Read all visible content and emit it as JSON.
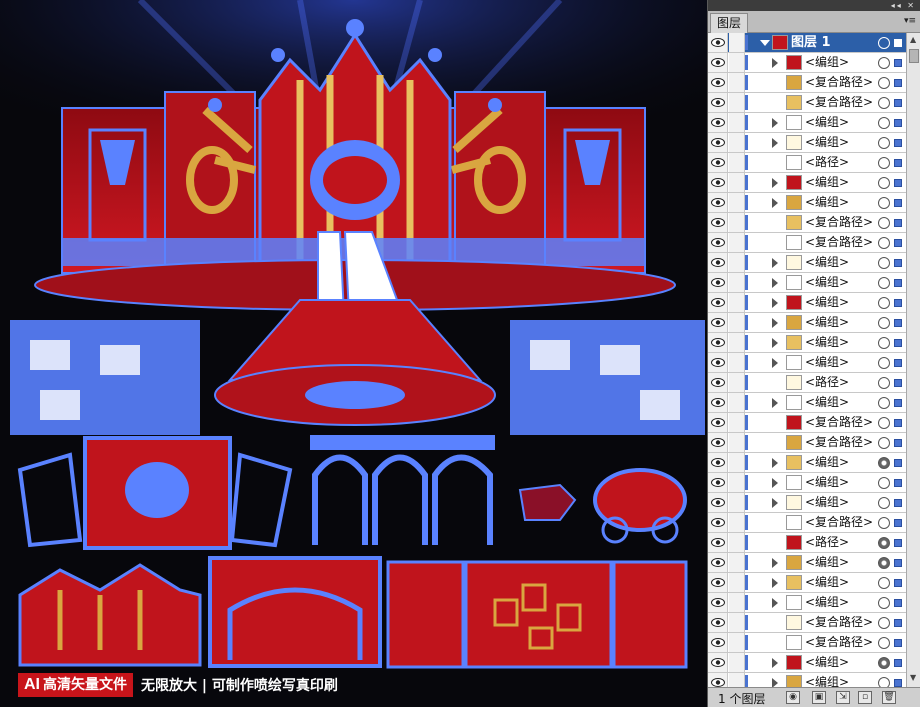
{
  "panel": {
    "tab_label": "图层",
    "menu_icon": "panel-menu-icon",
    "top_layer": {
      "label": "图层 1"
    },
    "rows": [
      {
        "label": "<编组>",
        "expand": true,
        "target": "empty"
      },
      {
        "label": "<复合路径>",
        "expand": false,
        "target": "empty"
      },
      {
        "label": "<复合路径>",
        "expand": false,
        "target": "empty"
      },
      {
        "label": "<编组>",
        "expand": true,
        "target": "empty"
      },
      {
        "label": "<编组>",
        "expand": true,
        "target": "empty"
      },
      {
        "label": "<路径>",
        "expand": false,
        "target": "empty"
      },
      {
        "label": "<编组>",
        "expand": true,
        "target": "empty"
      },
      {
        "label": "<编组>",
        "expand": true,
        "target": "empty"
      },
      {
        "label": "<复合路径>",
        "expand": false,
        "target": "empty"
      },
      {
        "label": "<复合路径>",
        "expand": false,
        "target": "empty"
      },
      {
        "label": "<编组>",
        "expand": true,
        "target": "empty"
      },
      {
        "label": "<编组>",
        "expand": true,
        "target": "empty"
      },
      {
        "label": "<编组>",
        "expand": true,
        "target": "empty"
      },
      {
        "label": "<编组>",
        "expand": true,
        "target": "empty"
      },
      {
        "label": "<编组>",
        "expand": true,
        "target": "empty"
      },
      {
        "label": "<编组>",
        "expand": true,
        "target": "empty"
      },
      {
        "label": "<路径>",
        "expand": false,
        "target": "empty"
      },
      {
        "label": "<编组>",
        "expand": true,
        "target": "empty"
      },
      {
        "label": "<复合路径>",
        "expand": false,
        "target": "empty"
      },
      {
        "label": "<复合路径>",
        "expand": false,
        "target": "empty"
      },
      {
        "label": "<编组>",
        "expand": true,
        "target": "filled"
      },
      {
        "label": "<编组>",
        "expand": true,
        "target": "empty"
      },
      {
        "label": "<编组>",
        "expand": true,
        "target": "empty"
      },
      {
        "label": "<复合路径>",
        "expand": false,
        "target": "empty"
      },
      {
        "label": "<路径>",
        "expand": false,
        "target": "filled"
      },
      {
        "label": "<编组>",
        "expand": true,
        "target": "filled"
      },
      {
        "label": "<编组>",
        "expand": true,
        "target": "empty"
      },
      {
        "label": "<编组>",
        "expand": true,
        "target": "empty"
      },
      {
        "label": "<复合路径>",
        "expand": false,
        "target": "empty"
      },
      {
        "label": "<复合路径>",
        "expand": false,
        "target": "empty"
      },
      {
        "label": "<编组>",
        "expand": true,
        "target": "filled"
      },
      {
        "label": "<编组>",
        "expand": true,
        "target": "empty"
      }
    ],
    "status_count": "1 个图层"
  },
  "banner": {
    "tag_ai": "AI",
    "tag_text": "高清矢量文件",
    "text": "无限放大 | 可制作喷绘写真印刷"
  },
  "colors": {
    "selection_blue": "#5a82ff",
    "stage_red": "#c0141c",
    "gold": "#d9a640",
    "layer_selected": "#2c5fa8"
  }
}
